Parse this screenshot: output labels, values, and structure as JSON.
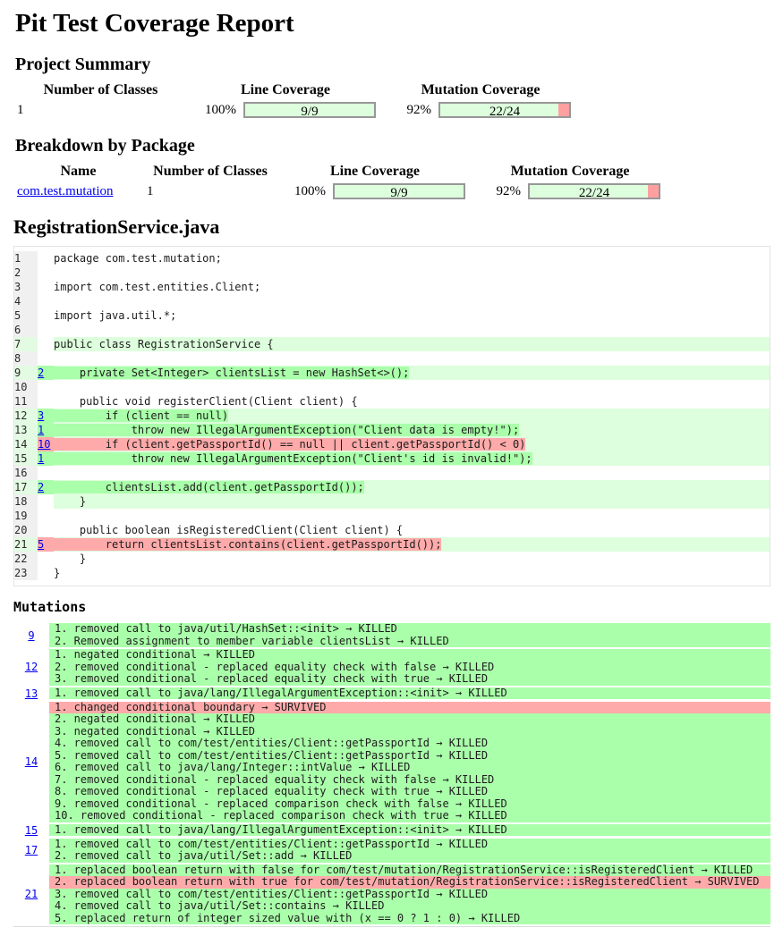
{
  "page": {
    "title": "Pit Test Coverage Report"
  },
  "colors": {
    "killed_green": "#aaffaa",
    "survived_pink": "#ffaaaa",
    "line_covered_green": "#ddffdd",
    "gutter_gray": "#f0f0f0",
    "bar_red": "#ffa0a0",
    "link_blue": "#0000ee"
  },
  "project_summary": {
    "heading": "Project Summary",
    "columns": [
      "Number of Classes",
      "Line Coverage",
      "Mutation Coverage"
    ],
    "number_of_classes": "1",
    "line_coverage": {
      "percent": "100%",
      "label": "9/9",
      "fraction": 100
    },
    "mutation_coverage": {
      "percent": "92%",
      "label": "22/24",
      "fraction": 92
    }
  },
  "package_breakdown": {
    "heading": "Breakdown by Package",
    "columns": [
      "Name",
      "Number of Classes",
      "Line Coverage",
      "Mutation Coverage"
    ],
    "rows": [
      {
        "name": "com.test.mutation",
        "classes": "1",
        "line_coverage": {
          "percent": "100%",
          "label": "9/9",
          "fraction": 100
        },
        "mutation_coverage": {
          "percent": "92%",
          "label": "22/24",
          "fraction": 92
        }
      }
    ]
  },
  "source": {
    "heading": "RegistrationService.java",
    "lines": [
      {
        "num": "1",
        "num_cov": false,
        "count": "",
        "count_status": "",
        "covered": false,
        "span": "",
        "code": "package com.test.mutation;"
      },
      {
        "num": "2",
        "num_cov": false,
        "count": "",
        "count_status": "",
        "covered": false,
        "span": "",
        "code": ""
      },
      {
        "num": "3",
        "num_cov": false,
        "count": "",
        "count_status": "",
        "covered": false,
        "span": "",
        "code": "import com.test.entities.Client;"
      },
      {
        "num": "4",
        "num_cov": false,
        "count": "",
        "count_status": "",
        "covered": false,
        "span": "",
        "code": ""
      },
      {
        "num": "5",
        "num_cov": false,
        "count": "",
        "count_status": "",
        "covered": false,
        "span": "",
        "code": "import java.util.*;"
      },
      {
        "num": "6",
        "num_cov": false,
        "count": "",
        "count_status": "",
        "covered": false,
        "span": "",
        "code": ""
      },
      {
        "num": "7",
        "num_cov": true,
        "count": "",
        "count_status": "",
        "covered": true,
        "span": "",
        "code": "public class RegistrationService {"
      },
      {
        "num": "8",
        "num_cov": false,
        "count": "",
        "count_status": "",
        "covered": false,
        "span": "",
        "code": ""
      },
      {
        "num": "9",
        "num_cov": true,
        "count": "2",
        "count_status": "killed",
        "covered": true,
        "span": "killed",
        "code": "    private Set<Integer> clientsList = new HashSet<>();"
      },
      {
        "num": "10",
        "num_cov": false,
        "count": "",
        "count_status": "",
        "covered": false,
        "span": "",
        "code": ""
      },
      {
        "num": "11",
        "num_cov": false,
        "count": "",
        "count_status": "",
        "covered": false,
        "span": "",
        "code": "    public void registerClient(Client client) {"
      },
      {
        "num": "12",
        "num_cov": true,
        "count": "3",
        "count_status": "killed",
        "covered": true,
        "span": "killed",
        "code": "        if (client == null)"
      },
      {
        "num": "13",
        "num_cov": true,
        "count": "1",
        "count_status": "killed",
        "covered": true,
        "span": "killed",
        "code": "            throw new IllegalArgumentException(\"Client data is empty!\");"
      },
      {
        "num": "14",
        "num_cov": true,
        "count": "10",
        "count_status": "survived",
        "covered": true,
        "span": "survived",
        "code": "        if (client.getPassportId() == null || client.getPassportId() < 0)"
      },
      {
        "num": "15",
        "num_cov": true,
        "count": "1",
        "count_status": "killed",
        "covered": true,
        "span": "killed",
        "code": "            throw new IllegalArgumentException(\"Client's id is invalid!\");"
      },
      {
        "num": "16",
        "num_cov": false,
        "count": "",
        "count_status": "",
        "covered": false,
        "span": "",
        "code": ""
      },
      {
        "num": "17",
        "num_cov": true,
        "count": "2",
        "count_status": "killed",
        "covered": true,
        "span": "killed",
        "code": "        clientsList.add(client.getPassportId());"
      },
      {
        "num": "18",
        "num_cov": false,
        "count": "",
        "count_status": "",
        "covered": true,
        "span": "",
        "code": "    }"
      },
      {
        "num": "19",
        "num_cov": false,
        "count": "",
        "count_status": "",
        "covered": false,
        "span": "",
        "code": ""
      },
      {
        "num": "20",
        "num_cov": false,
        "count": "",
        "count_status": "",
        "covered": false,
        "span": "",
        "code": "    public boolean isRegisteredClient(Client client) {"
      },
      {
        "num": "21",
        "num_cov": true,
        "count": "5",
        "count_status": "survived",
        "covered": true,
        "span": "survived",
        "code": "        return clientsList.contains(client.getPassportId());"
      },
      {
        "num": "22",
        "num_cov": false,
        "count": "",
        "count_status": "",
        "covered": false,
        "span": "",
        "code": "    }"
      },
      {
        "num": "23",
        "num_cov": false,
        "count": "",
        "count_status": "",
        "covered": false,
        "span": "",
        "code": "}"
      }
    ]
  },
  "mutations": {
    "heading": "Mutations",
    "groups": [
      {
        "line": "9",
        "items": [
          {
            "text": "1. removed call to java/util/HashSet::<init> → KILLED",
            "status": "KILLED"
          },
          {
            "text": "2. Removed assignment to member variable clientsList → KILLED",
            "status": "KILLED"
          }
        ]
      },
      {
        "line": "12",
        "items": [
          {
            "text": "1. negated conditional → KILLED",
            "status": "KILLED"
          },
          {
            "text": "2. removed conditional - replaced equality check with false → KILLED",
            "status": "KILLED"
          },
          {
            "text": "3. removed conditional - replaced equality check with true → KILLED",
            "status": "KILLED"
          }
        ]
      },
      {
        "line": "13",
        "items": [
          {
            "text": "1. removed call to java/lang/IllegalArgumentException::<init> → KILLED",
            "status": "KILLED"
          }
        ]
      },
      {
        "line": "14",
        "items": [
          {
            "text": "1. changed conditional boundary → SURVIVED",
            "status": "SURVIVED"
          },
          {
            "text": "2. negated conditional → KILLED",
            "status": "KILLED"
          },
          {
            "text": "3. negated conditional → KILLED",
            "status": "KILLED"
          },
          {
            "text": "4. removed call to com/test/entities/Client::getPassportId → KILLED",
            "status": "KILLED"
          },
          {
            "text": "5. removed call to com/test/entities/Client::getPassportId → KILLED",
            "status": "KILLED"
          },
          {
            "text": "6. removed call to java/lang/Integer::intValue → KILLED",
            "status": "KILLED"
          },
          {
            "text": "7. removed conditional - replaced equality check with false → KILLED",
            "status": "KILLED"
          },
          {
            "text": "8. removed conditional - replaced equality check with true → KILLED",
            "status": "KILLED"
          },
          {
            "text": "9. removed conditional - replaced comparison check with false → KILLED",
            "status": "KILLED"
          },
          {
            "text": "10. removed conditional - replaced comparison check with true → KILLED",
            "status": "KILLED"
          }
        ]
      },
      {
        "line": "15",
        "items": [
          {
            "text": "1. removed call to java/lang/IllegalArgumentException::<init> → KILLED",
            "status": "KILLED"
          }
        ]
      },
      {
        "line": "17",
        "items": [
          {
            "text": "1. removed call to com/test/entities/Client::getPassportId → KILLED",
            "status": "KILLED"
          },
          {
            "text": "2. removed call to java/util/Set::add → KILLED",
            "status": "KILLED"
          }
        ]
      },
      {
        "line": "21",
        "items": [
          {
            "text": "1. replaced boolean return with false for com/test/mutation/RegistrationService::isRegisteredClient → KILLED",
            "status": "KILLED"
          },
          {
            "text": "2. replaced boolean return with true for com/test/mutation/RegistrationService::isRegisteredClient → SURVIVED",
            "status": "SURVIVED"
          },
          {
            "text": "3. removed call to com/test/entities/Client::getPassportId → KILLED",
            "status": "KILLED"
          },
          {
            "text": "4. removed call to java/util/Set::contains → KILLED",
            "status": "KILLED"
          },
          {
            "text": "5. replaced return of integer sized value with (x == 0 ? 1 : 0) → KILLED",
            "status": "KILLED"
          }
        ]
      }
    ]
  }
}
